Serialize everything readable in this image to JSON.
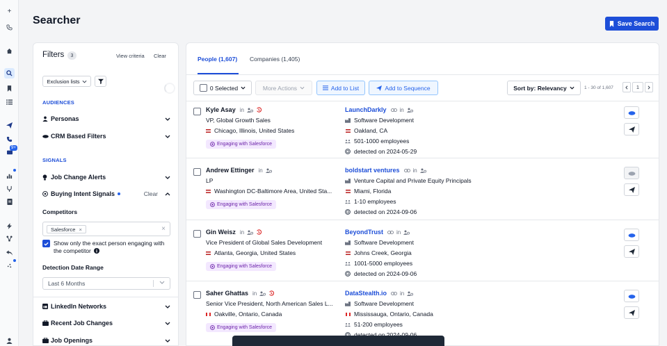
{
  "header": {
    "title": "Searcher",
    "save_search_label": "Save Search"
  },
  "rail": {
    "badge": "9+"
  },
  "filters": {
    "title": "Filters",
    "count": "3",
    "view_criteria": "View criteria",
    "clear": "Clear",
    "exclusion_lists": "Exclusion lists",
    "section_audiences": "AUDIENCES",
    "section_signals": "SIGNALS",
    "personas": "Personas",
    "crm": "CRM Based Filters",
    "job_change": "Job Change Alerts",
    "buying_intent": "Buying Intent Signals",
    "buying_intent_clear": "Clear",
    "competitors_label": "Competitors",
    "competitor_tag": "Salesforce",
    "show_only_text": "Show only the exact person engaging with the competitor",
    "detection_label": "Detection Date Range",
    "detection_value": "Last 6 Months",
    "linkedin": "LinkedIn Networks",
    "recent_job": "Recent Job Changes",
    "job_openings": "Job Openings"
  },
  "tabs": {
    "people": "People (1,607)",
    "companies": "Companies (1,405)"
  },
  "toolbar": {
    "selected": "0 Selected",
    "more_actions": "More Actions",
    "add_to_list": "Add to List",
    "add_to_sequence": "Add to Sequence",
    "sort": "Sort by: Relevancy",
    "range": "1 - 30 of 1,607",
    "page": "1"
  },
  "people": [
    {
      "name": "Kyle Asay",
      "title": "VP, Global Growth Sales",
      "location": "Chicago, Illinois, United States",
      "flag": "us",
      "badge": "Engaging with Salesforce",
      "company": "LaunchDarkly",
      "industry": "Software Development",
      "company_location": "Oakland, CA",
      "company_flag": "us",
      "employees": "501-1000 employees",
      "detected": "detected on 2024-05-29",
      "crm_active": true
    },
    {
      "name": "Andrew Ettinger",
      "title": "LP",
      "location": "Washington DC-Baltimore Area, United Sta...",
      "flag": "us",
      "badge": "Engaging with Salesforce",
      "company": "boldstart ventures",
      "industry": "Venture Capital and Private Equity Principals",
      "company_location": "Miami, Florida",
      "company_flag": "us",
      "employees": "1-10 employees",
      "detected": "detected on 2024-09-06",
      "crm_active": false
    },
    {
      "name": "Gin Weisz",
      "title": "Vice President of Global Sales Development",
      "location": "Atlanta, Georgia, United States",
      "flag": "us",
      "badge": "Engaging with Salesforce",
      "company": "BeyondTrust",
      "industry": "Software Development",
      "company_location": "Johns Creek, Georgia",
      "company_flag": "us",
      "employees": "1001-5000 employees",
      "detected": "detected on 2024-09-06",
      "crm_active": true
    },
    {
      "name": "Saher Ghattas",
      "title": "Senior Vice President, North American Sales L...",
      "location": "Oakville, Ontario, Canada",
      "flag": "ca",
      "badge": "Engaging with Salesforce",
      "company": "DataStealth.io",
      "industry": "Software Development",
      "company_location": "Mississauga, Ontario, Canada",
      "company_flag": "ca",
      "employees": "51-200 employees",
      "detected": "detected on 2024-09-06",
      "crm_active": true
    }
  ],
  "colors": {
    "accent": "#1d4ed8",
    "badge_bg": "#f3e8ff",
    "badge_text": "#6b21a8"
  }
}
